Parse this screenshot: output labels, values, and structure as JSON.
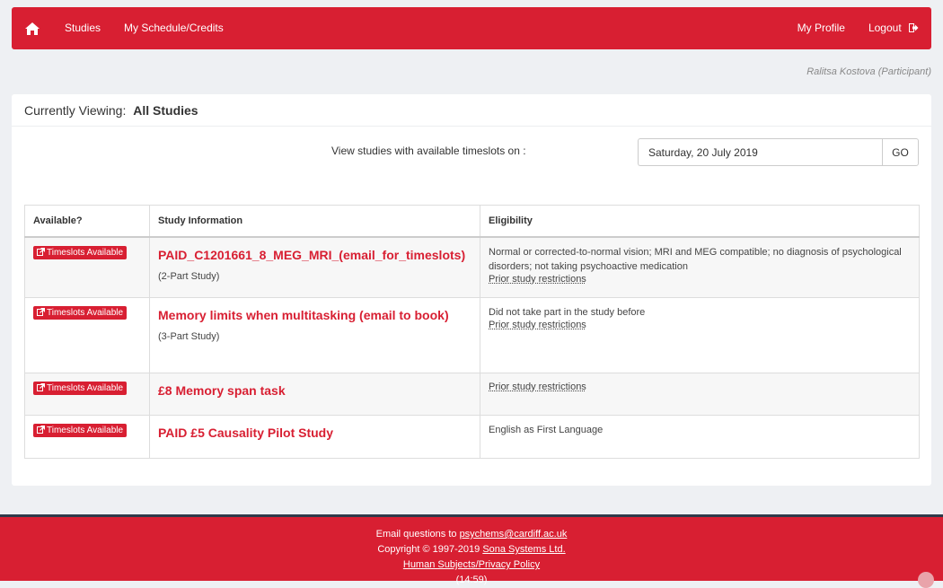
{
  "nav": {
    "home_icon": "home-icon",
    "studies": "Studies",
    "schedule": "My Schedule/Credits",
    "profile": "My Profile",
    "logout": "Logout",
    "logout_icon": "logout-icon"
  },
  "user": "Ralitsa Kostova (Participant)",
  "panel": {
    "viewing_label": "Currently Viewing:",
    "viewing_value": "All Studies",
    "filter_label": "View studies with available timeslots on :",
    "date_value": "Saturday, 20 July 2019",
    "go": "GO"
  },
  "table": {
    "headers": [
      "Available?",
      "Study Information",
      "Eligibility"
    ],
    "badge_label": "Timeslots Available",
    "restriction_label": "Prior study restrictions",
    "rows": [
      {
        "title": "PAID_C1201661_8_MEG_MRI_(email_for_timeslots)",
        "parts": "(2-Part Study)",
        "eligibility": "Normal or corrected-to-normal vision; MRI and MEG compatible; no diagnosis of psychological disorders; not taking psychoactive medication"
      },
      {
        "title": "Memory limits when multitasking (email to book)",
        "parts": "(3-Part Study)",
        "eligibility": "Did not take part in the study before"
      },
      {
        "title": "£8 Memory span task"
      },
      {
        "title": "PAID £5 Causality Pilot Study",
        "eligibility": "English as First Language"
      }
    ]
  },
  "footer": {
    "email_prefix": "Email questions to ",
    "email": "psychems@cardiff.ac.uk",
    "copyright_prefix": "Copyright © 1997-2019 ",
    "company": "Sona Systems Ltd.",
    "privacy": "Human Subjects/Privacy Policy",
    "time": "(14:59)"
  },
  "colors": {
    "brand_red": "#d81f32",
    "page_bg": "#eef0f3"
  }
}
